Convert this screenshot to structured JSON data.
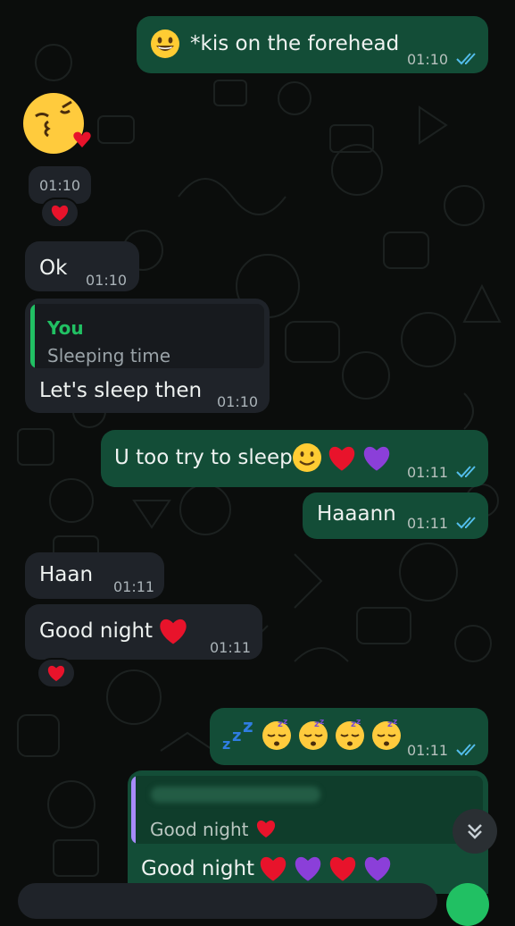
{
  "messages": {
    "m1": {
      "text": "*kis on the forehead",
      "time": "01:10"
    },
    "m2": {
      "time": "01:10"
    },
    "m3": {
      "text": "Ok",
      "time": "01:10"
    },
    "m4": {
      "quote_author": "You",
      "quote_text": "Sleeping time",
      "text": "Let's sleep then",
      "time": "01:10"
    },
    "m5": {
      "text": "U too try to sleep",
      "time": "01:11"
    },
    "m6": {
      "text": "Haaann",
      "time": "01:11"
    },
    "m7": {
      "text": "Haan",
      "time": "01:11"
    },
    "m8": {
      "text": "Good night",
      "time": "01:11"
    },
    "m9": {
      "time": "01:11"
    },
    "m10": {
      "quote_text": "Good night",
      "text": "Good night"
    }
  },
  "colors": {
    "outgoing_bubble": "#134d37",
    "incoming_bubble": "#1f2329",
    "quote_bar_you": "#21c063",
    "quote_bar_other": "#a78bfa",
    "read_ticks": "#53bdeb",
    "heart_red": "#e8132b",
    "heart_purple": "#8b3fd9"
  },
  "icons": [
    "double-check-icon",
    "heart-icon",
    "scroll-down-chevron-icon",
    "kiss-emoji",
    "smile-emoji",
    "sleeping-emoji",
    "zzz-emoji"
  ]
}
